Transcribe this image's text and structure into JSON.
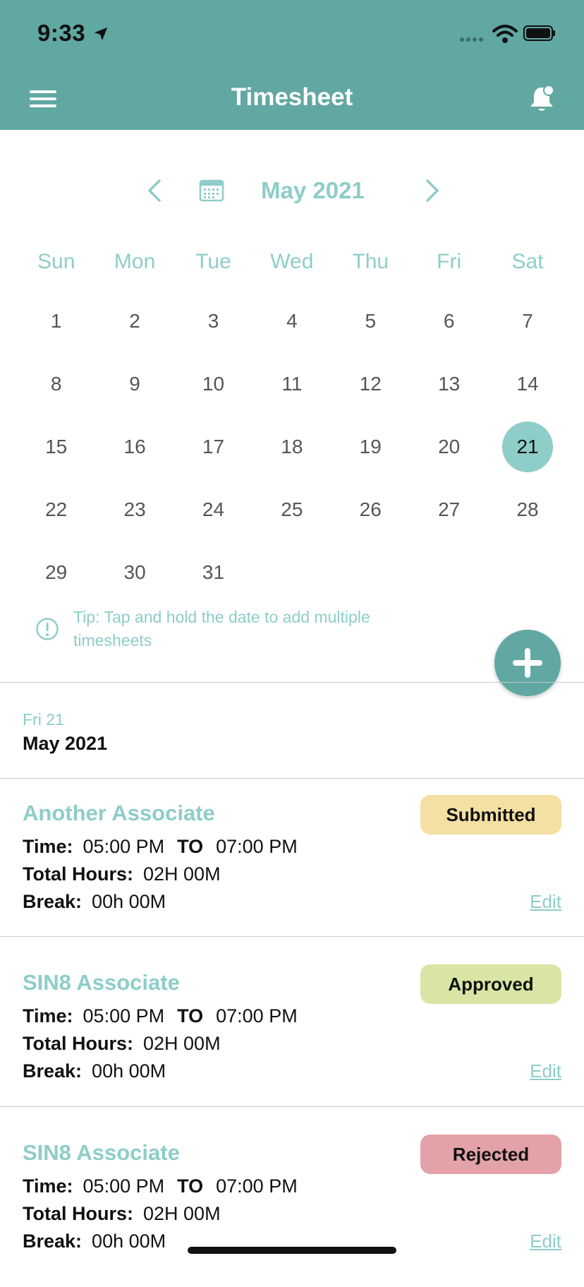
{
  "status_bar": {
    "time": "9:33"
  },
  "header": {
    "title": "Timesheet"
  },
  "calendar": {
    "month_label": "May 2021",
    "weekdays": [
      "Sun",
      "Mon",
      "Tue",
      "Wed",
      "Thu",
      "Fri",
      "Sat"
    ],
    "leading_blanks": 0,
    "days": [
      "1",
      "2",
      "3",
      "4",
      "5",
      "6",
      "7",
      "8",
      "9",
      "10",
      "11",
      "12",
      "13",
      "14",
      "15",
      "16",
      "17",
      "18",
      "19",
      "20",
      "21",
      "22",
      "23",
      "24",
      "25",
      "26",
      "27",
      "28",
      "29",
      "30",
      "31"
    ],
    "selected_day": "21"
  },
  "tip": {
    "text": "Tip: Tap and hold the date to add multiple timesheets"
  },
  "selected_date": {
    "day": "Fri 21",
    "month": "May 2021"
  },
  "labels": {
    "time": "Time:",
    "to": "TO",
    "total_hours": "Total Hours:",
    "break": "Break:",
    "edit": "Edit"
  },
  "entries": [
    {
      "name": "Another Associate",
      "status": "Submitted",
      "status_color": "#f4e0a3",
      "start": "05:00 PM",
      "end": "07:00 PM",
      "total_hours": "02H 00M",
      "break": "00h 00M"
    },
    {
      "name": "SIN8 Associate",
      "status": "Approved",
      "status_color": "#d9e5a5",
      "start": "05:00 PM",
      "end": "07:00 PM",
      "total_hours": "02H 00M",
      "break": "00h 00M"
    },
    {
      "name": "SIN8 Associate",
      "status": "Rejected",
      "status_color": "#e3a2a8",
      "start": "05:00 PM",
      "end": "07:00 PM",
      "total_hours": "02H 00M",
      "break": "00h 00M"
    }
  ],
  "colors": {
    "primary": "#61a7a2",
    "accent": "#8ecdc8"
  }
}
